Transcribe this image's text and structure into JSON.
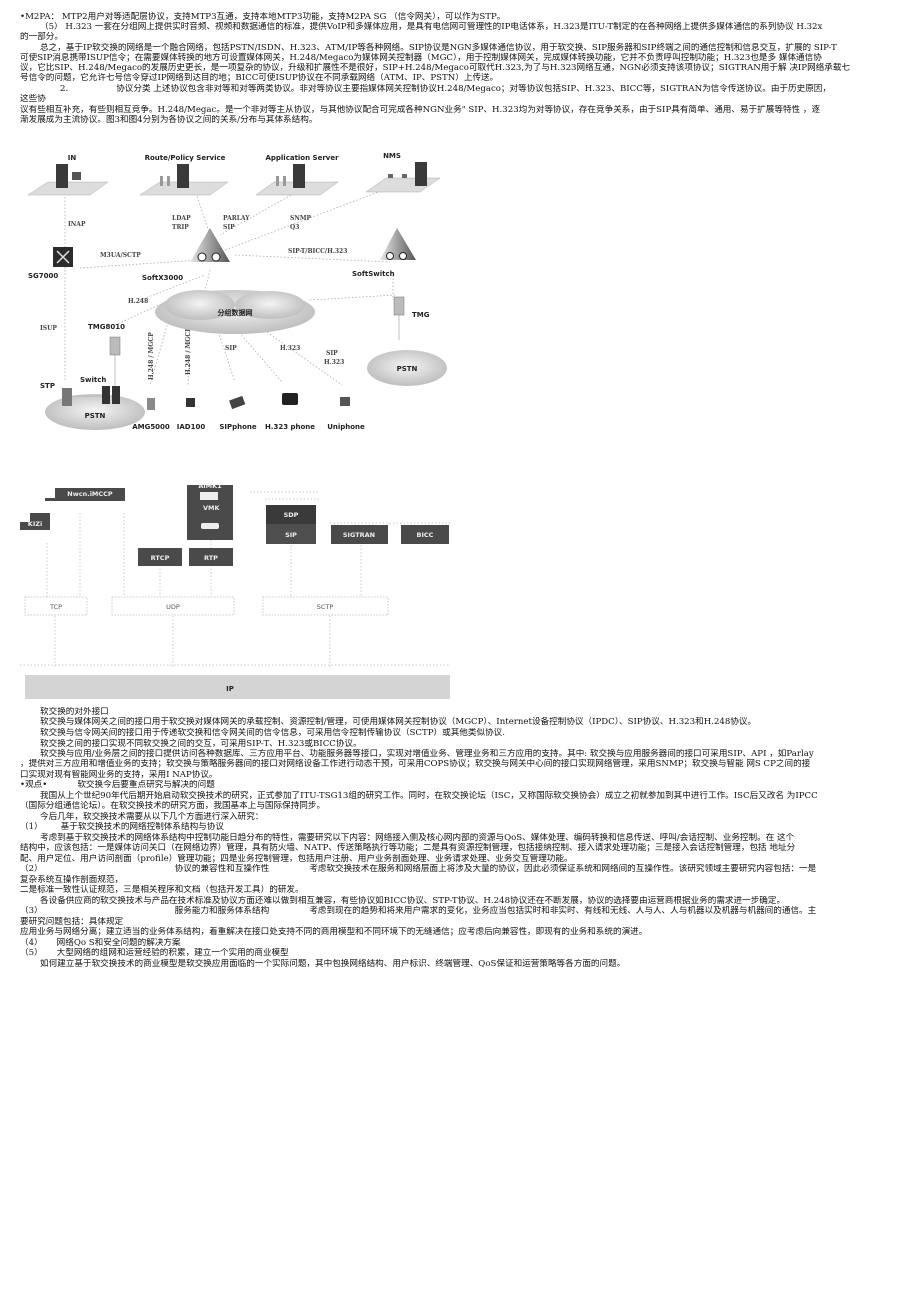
{
  "intro": {
    "m2pa": "•M2PA： MTP2用户对等适配层协议，支持MTP3互通，支持本地MTP3功能，支持M2PA SG （信令网关），可以作为STP。",
    "h323_line1": "（5） H.323 一套在分组网上提供实时音频、视频和数据通信的标准，提供VoIP和多媒体应用，是具有电信网可管理性的IP电话体系，H.323是ITU-T制定的在各种网络上提供多媒体通信的系列协议 H.32x",
    "h323_line2": "的一部分。",
    "summary_line1": "总之，基于IP软交换的网络是一个融合网络，包括PSTN/ISDN、H.323、ATM/IP等各种网络。SIP协议是NGN多媒体通信协议，用于软交换、SIP服务器和SIP终端之间的通信控制和信息交互，扩展的 SIP-T",
    "summary_line2": "可使SIP消息携带ISUP信令；在需要媒体转换的地方可设置媒体网关，H.248/Megaco为媒体网关控制器（MGC），用于控制媒体网关，完成媒体转换功能，它并不负责呼叫控制功能；H.323也是多 媒体通信协",
    "summary_line3": "议，它比SIP、H.248/Megaco的发展历史更长，是一项复杂的协议，升级和扩展性不是很好，SIP+H.248/Megaco可取代H.323,为了与H.323网络互通，NGN必须支持该项协议；SIGTRAN用于解  决IP网络承载七",
    "summary_line4": "号信令的问题，它允许七号信令穿过IP网络到达目的地；BICC可使ISUP协议在不同承载网络（ATM、IP、PSTN）上传送。",
    "class_num": "2.",
    "class_line1": "协议分类   上述协议包含非对等和对等两类协议。非对等协议主要指媒体网关控制协议H.248/Megaco；对等协议包括SIP、H.323、BICC等，SIGTRAN为信令传送协议。由于历史原因，",
    "class_line2": "这些协",
    "class_line3": "议有些相互补充，有些则相互竞争。H.248/Megac。是一个非对等主从协议，与其他协议配合可完成各种NGN业务\" SIP、H.323均为对等协议，存在竞争关系，由于SIP具有简单、通用、易于扩展等特性 ，逐",
    "class_line4": "渐发展成为主流协议。图3和图4分别为各协议之间的关系/分布与其体系结构。"
  },
  "figure1": {
    "servers": [
      "IN",
      "Route/Policy Service",
      "Application Server",
      "NMS"
    ],
    "protocols": {
      "inap": "INAP",
      "ldap": "LDAP",
      "trip": "TRIP",
      "parlay": "PARLAY",
      "sip": "SIP",
      "snmp": "SNMP",
      "q3": "Q3",
      "m3ua": "M3UA/SCTP",
      "sipt": "SIP-T/BICC/H.323",
      "h248": "H.248",
      "isup": "ISUP",
      "mgcp1": "H.248 / MGCP",
      "mgcp2": "H.248 / MGCP",
      "sip2": "SIP",
      "h323": "H.323",
      "sip3": "SIP",
      "h323b": "H.323"
    },
    "nodes": {
      "sg": "SG7000",
      "softx": "SoftX3000",
      "softswitch": "SoftSwitch",
      "tmg8010": "TMG8010",
      "tmg": "TMG",
      "cloud": "分组数据网",
      "stp": "STP",
      "switch": "Switch",
      "pstn_left": "PSTN",
      "pstn_right": "PSTN",
      "amg": "AMG5000",
      "iad": "IAD100",
      "sipphone": "SIPphone",
      "h323phone": "H.323 phone",
      "uniphone": "Uniphone"
    }
  },
  "figure2": {
    "top_boxes": {
      "kizi": "KIZi",
      "nwcn": "Nwcn.iMCCP",
      "aimk": "AiMK1",
      "vmk": "VMK",
      "sdp": "SDP",
      "sip": "SIP",
      "sigtran": "SIGTRAN",
      "bicc": "BICC",
      "rtcp": "RTCP",
      "rtp": "RTP"
    },
    "transport": [
      "TCP",
      "UDP",
      "SCTP"
    ],
    "network": "IP"
  },
  "interfaces": {
    "title": "软交换的对外接口",
    "p1": "软交换与媒体网关之间的接口用于软交换对媒体网关的承载控制、资源控制/管理，可使用媒体网关控制协议（MGCP）、Internet设备控制协议（IPDC）、SIP协议、H.323和H.248协议。",
    "p2": "软交换与信令网关间的接口用于传递软交换和信令网关间的信令信息，可采用信令控制传输协议（SCTP）或其他类似协议.",
    "p3": "软交换之间的接口实现不同软交换之间的交互，可采用SIP-T、H.323或BICC协议。",
    "p4_line1": "软交换与应用/业务层之间的接口提供访问各种数据库、三方应用平台、功能服务器等接口，实现对增值业务、管理业务和三方应用的支持。其中: 软交换与应用服务器间的接口可采用SIP、API ，如Parlay",
    "p4_line2": "，提供对三方应用和增值业务的支持；软交换与策略服务器间的接口对网络设备工作进行动态干预，可采用COPS协议；软交换与网关中心间的接口实现网络管理，采用SNMP；软交换与智能  网S  CP之间的接",
    "p4_line3": "口实现对现有智能网业务的支持，采用I NAP协议。"
  },
  "research": {
    "heading_prefix": "•观点•",
    "heading": "软交换今后要重点研究与解决的问题",
    "p1_line1": "我国从上个世纪90年代后期开始启动软交换技术的研究，正式参加了ITU-TSG13组的研究工作。同时，在软交换论坛（ISC，又称国际软交换协会）成立之初就参加到其中进行工作。ISC后又改名 为IPCC",
    "p1_line2": "（国际分组通信论坛）。在软交换技术的研究方面，我国基本上与国际保持同步。",
    "p2": "今后几年，软交换技术需要从以下几个方面进行深入研究：",
    "item1_num": "（1）",
    "item1_title": "基于软交换技术的网络控制体系结构与协议",
    "item1_line1": "考虑到基于软交换技术的网络体系结构中控制功能日趋分布的特性，需要研究以下内容：网络接入侧及核心网内部的资源与QoS、媒体处理、编码转换和信息传送、呼叫/会话控制、业务控制。在  这个",
    "item1_line2": "结构中，应该包括：一是媒体访问关口（在网络边界）管理，具有防火墙、NATP、传送策略执行等功能；二是具有资源控制管理，包括接纳控制、接入请求处理功能；三是接入会话控制管理，包括  地址分",
    "item1_line3": "配、用户定位、用户访问剖面（profile）管理功能；四是业务控制管理，包括用户注册、用户业务剖面处理、业务请求处理、业务交互管理功能。",
    "item2_num": "（2）",
    "item2_title": "协议的兼容性和互操作性",
    "item2_line1": "考虑软交换技术在服务和网络层面上将涉及大量的协议，因此必须保证系统和网络间的互操作性。该研究领域主要研究内容包括：一是",
    "item2_line2": "复杂系统互操作剖面规范，",
    "item2_line3": "二是标准一致性认证规范，三是相关程序和文档（包括开发工具）的研发。",
    "item2_line4": "各设备供应商的软交换技术与产品在技术标准及协议方面还难以做到相互兼容，有些协议如BICC协议、STP-T协议、H.248协议还在不断发展，协议的选择要由运营商根据业务的需求进一步确定。",
    "item3_num": "（3）",
    "item3_title": "服务能力和服务体系结构",
    "item3_line1": "考虑到现在的趋势和将来用户需求的变化，业务应当包括实时和非实时、有线和无线、人与人、人与机器以及机器与机器间的通信。主",
    "item3_line2": "要研究问题包括：具体规定",
    "item3_line3": "应用业务与网络分离；建立适当的业务体系结构，着重解决在接口处支持不同的商用模型和不同环境下的无缝通信；应考虑后向兼容性，即现有的业务和系统的演进。",
    "item4_num": "（4）",
    "item4_title": "网络Qo S和安全问题的解决方案",
    "item5_num": "（5）",
    "item5_title": "大型网络的组网和运营经验的积累，建立一个实用的商业模型",
    "item5_line1": "如何建立基于软交换技术的商业模型是软交换应用面临的一个实际问题，其中包换网络结构、用户标识、终端管理、QoS保证和运营策略等各方面的问题。"
  }
}
